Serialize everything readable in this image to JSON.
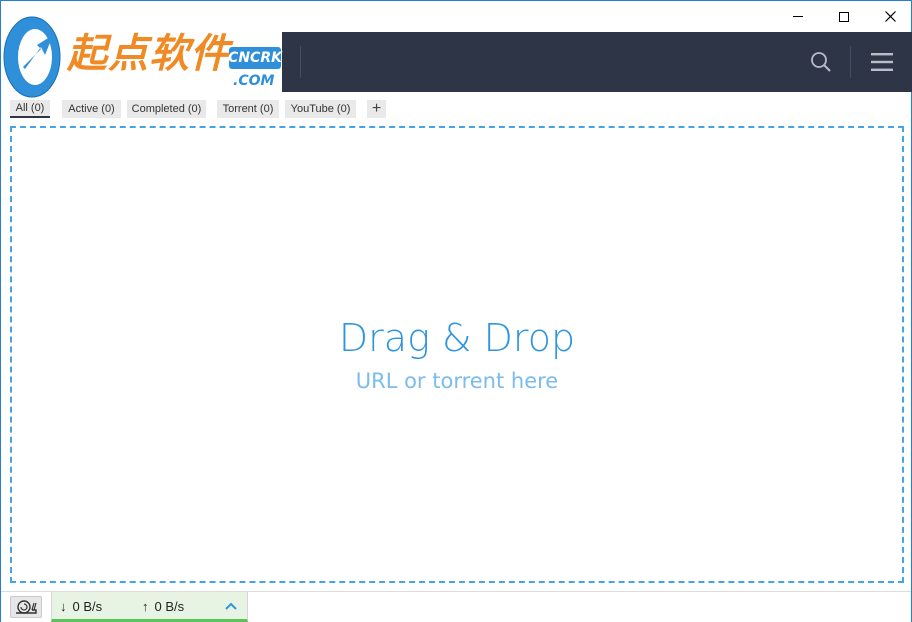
{
  "logo": {
    "text": "起点软件",
    "badge": "CNCRK",
    "domain": ".COM"
  },
  "window_controls": {
    "minimize_icon": "minimize-icon",
    "maximize_icon": "maximize-icon",
    "close_icon": "close-icon"
  },
  "header": {
    "search_icon": "search-icon",
    "menu_icon": "hamburger-menu-icon",
    "background_color": "#2e3547"
  },
  "tabs": [
    {
      "label": "All (0)",
      "active": true
    },
    {
      "label": "Active (0)",
      "active": false
    },
    {
      "label": "Completed (0)",
      "active": false
    },
    {
      "label": "Torrent (0)",
      "active": false
    },
    {
      "label": "YouTube (0)",
      "active": false
    }
  ],
  "add_tab_label": "+",
  "dropzone": {
    "title": "Drag & Drop",
    "subtitle": "URL or torrent here",
    "accent_color": "#2f95df"
  },
  "status": {
    "speed_limiter_icon": "snail-icon",
    "download_speed": "0 B/s",
    "upload_speed": "0 B/s",
    "download_arrow": "↓",
    "upload_arrow": "↑",
    "expand_icon": "chevron-up-icon",
    "accent_color": "#5cc25a"
  }
}
